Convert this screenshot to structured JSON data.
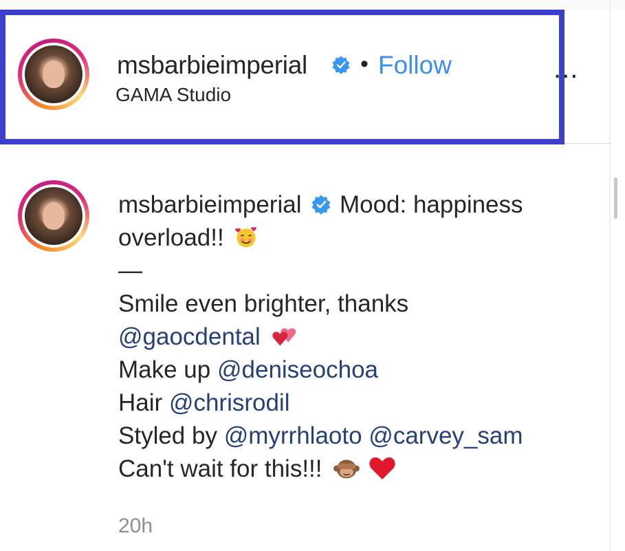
{
  "header": {
    "username": "msbarbieimperial",
    "separator": "•",
    "follow_label": "Follow",
    "location": "GAMA Studio",
    "more_label": "..."
  },
  "caption": {
    "username": "msbarbieimperial",
    "intro_1": "Mood: happiness",
    "intro_2": "overload!!",
    "dash": "—",
    "smile_line": "Smile even brighter, thanks",
    "dental_mention": "@gaocdental",
    "makeup_prefix": "Make up",
    "makeup_mention": "@deniseochoa",
    "hair_prefix": "Hair",
    "hair_mention": "@chrisrodil",
    "styled_prefix": "Styled by",
    "styled_mention_1": "@myrrhlaoto",
    "styled_mention_2": "@carvey_sam",
    "closing": "Can't wait for this!!!"
  },
  "timestamp": "20h",
  "colors": {
    "highlight_border": "#3b3fc9",
    "follow_blue": "#3a8ef6",
    "mention_blue": "#27407a",
    "verified_blue": "#3897f0",
    "muted": "#8e8e8e"
  },
  "icons": [
    "verified-badge-icon",
    "smiling-face-with-hearts-icon",
    "two-hearts-icon",
    "see-no-evil-monkey-icon",
    "red-heart-icon",
    "more-options-icon"
  ]
}
